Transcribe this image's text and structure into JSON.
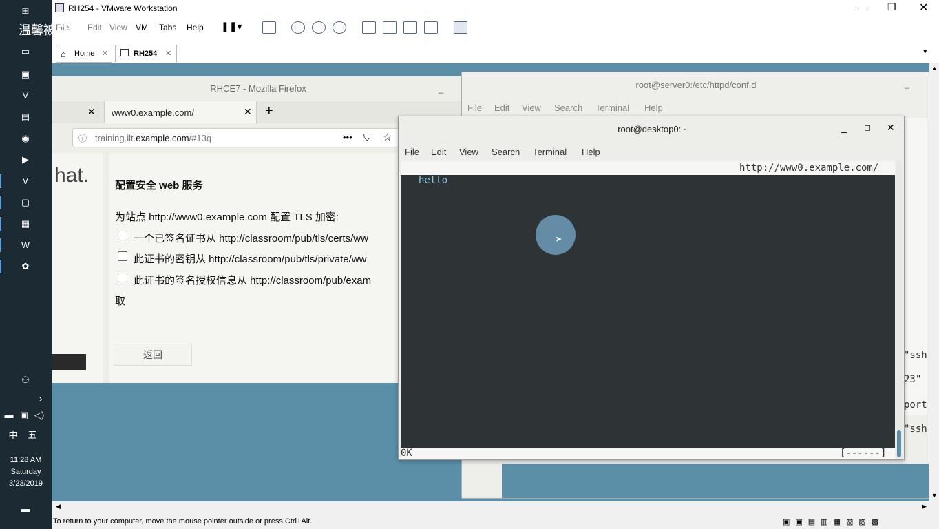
{
  "taskbar": {
    "clock_time": "11:28 AM",
    "clock_day": "Saturday",
    "clock_date": "3/23/2019",
    "ime_lang": "中",
    "ime_mode": "五"
  },
  "watermark": "温馨被白照",
  "vmware": {
    "title": "RH254 - VMware Workstation",
    "menu": [
      "File",
      "Edit",
      "View",
      "VM",
      "Tabs",
      "Help"
    ],
    "tabs": [
      {
        "label": "Home"
      },
      {
        "label": "RH254"
      }
    ],
    "status_text": "To return to your computer, move the mouse pointer outside or press Ctrl+Alt."
  },
  "firefox": {
    "title": "RHCE7 - Mozilla Firefox",
    "tab_label": "www0.example.com/",
    "url_prefix": "training.ilt.",
    "url_domain": "example.com",
    "url_suffix": "/#13q",
    "brand_fragment": "hat.",
    "heading": "配置安全 web 服务",
    "intro": "为站点 http://www0.example.com 配置 TLS 加密:",
    "items": [
      "一个已签名证书从 http://classroom/pub/tls/certs/ww",
      "此证书的密钥从 http://classroom/pub/tls/private/ww",
      "此证书的签名授权信息从 http://classroom/pub/exam"
    ],
    "trailing": "取",
    "back_button": "返回"
  },
  "server_terminal": {
    "title": "root@server0:/etc/httpd/conf.d",
    "menu": [
      "File",
      "Edit",
      "View",
      "Search",
      "Terminal",
      "Help"
    ],
    "side_fragments": [
      "\"ssh",
      "23\"",
      "port",
      "\"ssh"
    ]
  },
  "desktop_terminal": {
    "title": "root@desktop0:~",
    "menu": [
      "File",
      "Edit",
      "View",
      "Search",
      "Terminal",
      "Help"
    ],
    "url_line": "http://www0.example.com/",
    "output": "hello",
    "status_left": "0K",
    "status_right": "[------]"
  }
}
